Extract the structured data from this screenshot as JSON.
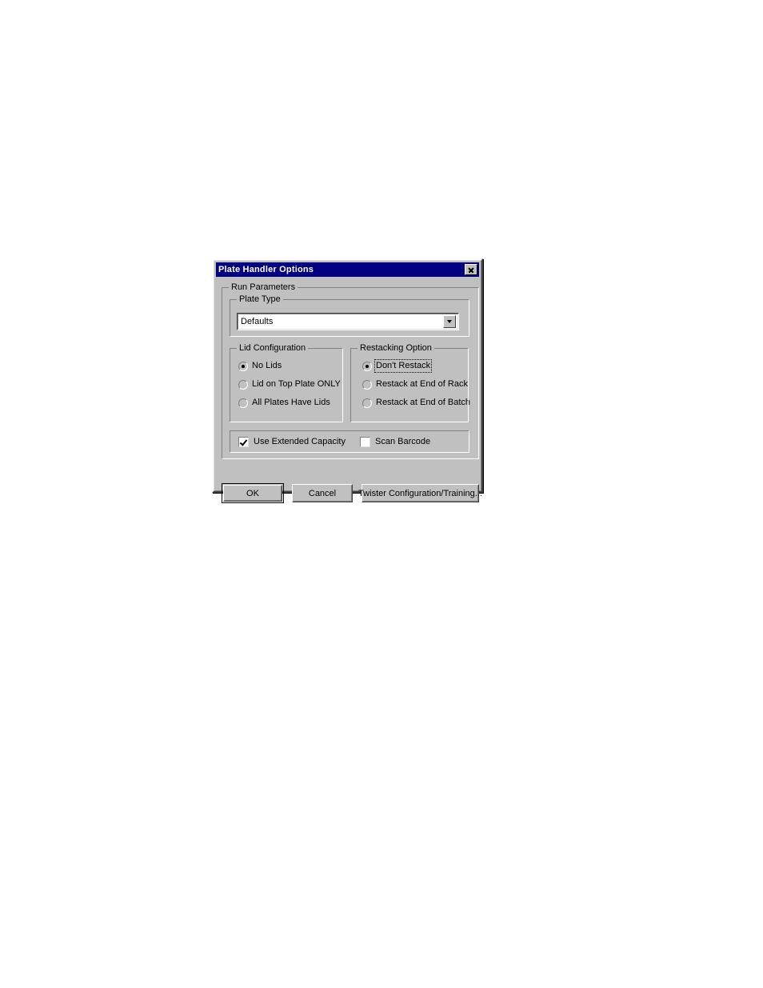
{
  "dialog": {
    "title": "Plate Handler Options",
    "close_icon": "close-icon",
    "title_bar_color": "#000080",
    "face_color": "#c0c0c0"
  },
  "run_parameters": {
    "label": "Run Parameters",
    "plate_type": {
      "label": "Plate Type",
      "selected": "Defaults",
      "dropdown_icon": "chevron-down-icon"
    },
    "lid_configuration": {
      "label": "Lid Configuration",
      "options": [
        {
          "label": "No Lids",
          "checked": true,
          "focused": false
        },
        {
          "label": "Lid on Top Plate ONLY",
          "checked": false,
          "focused": false
        },
        {
          "label": "All Plates Have Lids",
          "checked": false,
          "focused": false
        }
      ]
    },
    "restacking_option": {
      "label": "Restacking Option",
      "options": [
        {
          "label": "Don't Restack",
          "checked": true,
          "focused": true
        },
        {
          "label": "Restack at End of Rack",
          "checked": false,
          "focused": false
        },
        {
          "label": "Restack at End of Batch",
          "checked": false,
          "focused": false
        }
      ]
    },
    "checkboxes": [
      {
        "label": "Use Extended Capacity",
        "checked": true
      },
      {
        "label": "Scan Barcode",
        "checked": false
      }
    ]
  },
  "buttons": {
    "ok": "OK",
    "cancel": "Cancel",
    "twister": "Twister Configuration/Training..."
  }
}
